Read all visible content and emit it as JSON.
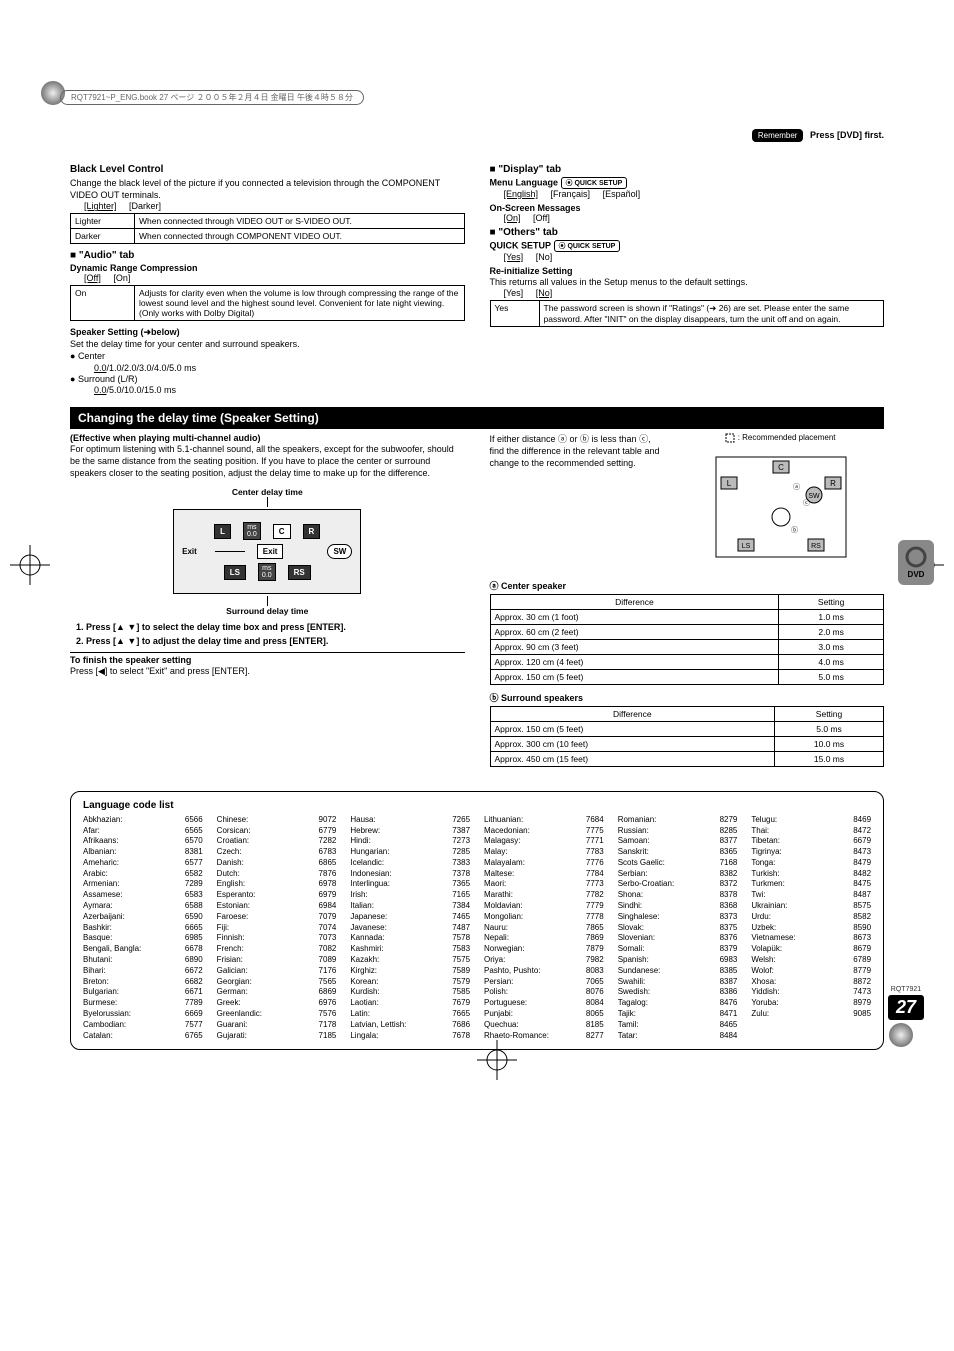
{
  "topbar_text": "RQT7921~P_ENG.book 27 ページ ２００５年２月４日 金曜日 午後４時５８分",
  "remember_pill": "Remember",
  "remember_text": "Press [DVD] first.",
  "left": {
    "blc_title": "Black Level Control",
    "blc_desc": "Change the black level of the picture if you connected a television through the COMPONENT VIDEO OUT terminals.",
    "blc_opts_lighter": "[Lighter]",
    "blc_opts_darker": "[Darker]",
    "blc_row1_k": "Lighter",
    "blc_row1_v": "When connected through VIDEO OUT or S-VIDEO OUT.",
    "blc_row2_k": "Darker",
    "blc_row2_v": "When connected through COMPONENT VIDEO OUT.",
    "audio_tab": "\"Audio\" tab",
    "drc_title": "Dynamic Range Compression",
    "drc_off": "[Off]",
    "drc_on": "[On]",
    "drc_row_k": "On",
    "drc_row_v": "Adjusts for clarity even when the volume is low through compressing the range of the lowest sound level and the highest sound level. Convenient for late night viewing. (Only works with Dolby Digital)",
    "spk_title": "Speaker Setting (➜below)",
    "spk_desc": "Set the delay time for your center and surround speakers.",
    "spk_center": "Center",
    "spk_center_vals": "0.0/1.0/2.0/3.0/4.0/5.0 ms",
    "spk_surr": "Surround (L/R)",
    "spk_surr_vals": "0.0/5.0/10.0/15.0 ms"
  },
  "right": {
    "display_tab": "\"Display\" tab",
    "menu_lang_title": "Menu Language",
    "menu_lang_opts": [
      "[English]",
      "[Français]",
      "[Español]"
    ],
    "osm_title": "On-Screen Messages",
    "osm_opts": [
      "[On]",
      "[Off]"
    ],
    "others_tab": "\"Others\" tab",
    "quick_title": "QUICK SETUP",
    "quick_opts": [
      "[Yes]",
      "[No]"
    ],
    "reinit_title": "Re-initialize Setting",
    "reinit_desc": "This returns all values in the Setup menus to the default settings.",
    "reinit_opts": [
      "[Yes]",
      "[No]"
    ],
    "reinit_row_k": "Yes",
    "reinit_row_v": "The password screen is shown if \"Ratings\" (➜ 26) are set. Please enter the same password. After \"INIT\" on the display disappears, turn the unit off and on again.",
    "quick_badge": "QUICK SETUP"
  },
  "delay": {
    "bar": "Changing the delay time (Speaker Setting)",
    "eff": "(Effective when playing multi-channel audio)",
    "para": "For optimum listening with 5.1-channel sound, all the speakers, except for the subwoofer, should be the same distance from the seating position. If you have to place the center or surround speakers closer to the seating position, adjust the delay time to make up for the difference.",
    "center_title": "Center delay time",
    "surround_title": "Surround delay time",
    "exit": "Exit",
    "ms": "ms",
    "ms_val": "0.0",
    "sp_L": "L",
    "sp_C": "C",
    "sp_R": "R",
    "sp_SW": "SW",
    "sp_LS": "LS",
    "sp_RS": "RS",
    "step1": "Press [▲ ▼] to select the delay time box and press [ENTER].",
    "step2": "Press [▲ ▼] to adjust the delay time and press [ENTER].",
    "finish_t": "To finish the speaker setting",
    "finish_b": "Press [◀] to select \"Exit\" and press [ENTER].",
    "either": "If either distance ⓐ or ⓑ is less than ⓒ, find the difference in the relevant table and change to the recommended setting.",
    "rec_placement": ": Recommended placement",
    "center_spk": "Center speaker",
    "surr_spk": "Surround speakers",
    "th_diff": "Difference",
    "th_set": "Setting",
    "center_rows": [
      [
        "Approx. 30 cm (1 foot)",
        "1.0 ms"
      ],
      [
        "Approx. 60 cm (2 feet)",
        "2.0 ms"
      ],
      [
        "Approx. 90 cm (3 feet)",
        "3.0 ms"
      ],
      [
        "Approx. 120 cm (4 feet)",
        "4.0 ms"
      ],
      [
        "Approx. 150 cm (5 feet)",
        "5.0 ms"
      ]
    ],
    "surr_rows": [
      [
        "Approx. 150 cm (5 feet)",
        "5.0 ms"
      ],
      [
        "Approx. 300 cm (10 feet)",
        "10.0 ms"
      ],
      [
        "Approx. 450 cm (15 feet)",
        "15.0 ms"
      ]
    ]
  },
  "lang": {
    "title": "Language code list",
    "cols": [
      [
        [
          "Abkhazian:",
          "6566"
        ],
        [
          "Afar:",
          "6565"
        ],
        [
          "Afrikaans:",
          "6570"
        ],
        [
          "Albanian:",
          "8381"
        ],
        [
          "Ameharic:",
          "6577"
        ],
        [
          "Arabic:",
          "6582"
        ],
        [
          "Armenian:",
          "7289"
        ],
        [
          "Assamese:",
          "6583"
        ],
        [
          "Aymara:",
          "6588"
        ],
        [
          "Azerbaijani:",
          "6590"
        ],
        [
          "Bashkir:",
          "6665"
        ],
        [
          "Basque:",
          "6985"
        ],
        [
          "Bengali, Bangla:",
          "6678"
        ],
        [
          "Bhutani:",
          "6890"
        ],
        [
          "Bihari:",
          "6672"
        ],
        [
          "Breton:",
          "6682"
        ],
        [
          "Bulgarian:",
          "6671"
        ],
        [
          "Burmese:",
          "7789"
        ],
        [
          "Byelorussian:",
          "6669"
        ],
        [
          "Cambodian:",
          "7577"
        ],
        [
          "Catalan:",
          "6765"
        ]
      ],
      [
        [
          "Chinese:",
          "9072"
        ],
        [
          "Corsican:",
          "6779"
        ],
        [
          "Croatian:",
          "7282"
        ],
        [
          "Czech:",
          "6783"
        ],
        [
          "Danish:",
          "6865"
        ],
        [
          "Dutch:",
          "7876"
        ],
        [
          "English:",
          "6978"
        ],
        [
          "Esperanto:",
          "6979"
        ],
        [
          "Estonian:",
          "6984"
        ],
        [
          "Faroese:",
          "7079"
        ],
        [
          "Fiji:",
          "7074"
        ],
        [
          "Finnish:",
          "7073"
        ],
        [
          "French:",
          "7082"
        ],
        [
          "Frisian:",
          "7089"
        ],
        [
          "Galician:",
          "7176"
        ],
        [
          "Georgian:",
          "7565"
        ],
        [
          "German:",
          "6869"
        ],
        [
          "Greek:",
          "6976"
        ],
        [
          "Greenlandic:",
          "7576"
        ],
        [
          "Guarani:",
          "7178"
        ],
        [
          "Gujarati:",
          "7185"
        ]
      ],
      [
        [
          "Hausa:",
          "7265"
        ],
        [
          "Hebrew:",
          "7387"
        ],
        [
          "Hindi:",
          "7273"
        ],
        [
          "Hungarian:",
          "7285"
        ],
        [
          "Icelandic:",
          "7383"
        ],
        [
          "Indonesian:",
          "7378"
        ],
        [
          "Interlingua:",
          "7365"
        ],
        [
          "Irish:",
          "7165"
        ],
        [
          "Italian:",
          "7384"
        ],
        [
          "Japanese:",
          "7465"
        ],
        [
          "Javanese:",
          "7487"
        ],
        [
          "Kannada:",
          "7578"
        ],
        [
          "Kashmiri:",
          "7583"
        ],
        [
          "Kazakh:",
          "7575"
        ],
        [
          "Kirghiz:",
          "7589"
        ],
        [
          "Korean:",
          "7579"
        ],
        [
          "Kurdish:",
          "7585"
        ],
        [
          "Laotian:",
          "7679"
        ],
        [
          "Latin:",
          "7665"
        ],
        [
          "Latvian, Lettish:",
          "7686"
        ],
        [
          "Lingala:",
          "7678"
        ]
      ],
      [
        [
          "Lithuanian:",
          "7684"
        ],
        [
          "Macedonian:",
          "7775"
        ],
        [
          "Malagasy:",
          "7771"
        ],
        [
          "Malay:",
          "7783"
        ],
        [
          "Malayalam:",
          "7776"
        ],
        [
          "Maltese:",
          "7784"
        ],
        [
          "Maori:",
          "7773"
        ],
        [
          "Marathi:",
          "7782"
        ],
        [
          "Moldavian:",
          "7779"
        ],
        [
          "Mongolian:",
          "7778"
        ],
        [
          "Nauru:",
          "7865"
        ],
        [
          "Nepali:",
          "7869"
        ],
        [
          "Norwegian:",
          "7879"
        ],
        [
          "Oriya:",
          "7982"
        ],
        [
          "Pashto, Pushto:",
          "8083"
        ],
        [
          "Persian:",
          "7065"
        ],
        [
          "Polish:",
          "8076"
        ],
        [
          "Portuguese:",
          "8084"
        ],
        [
          "Punjabi:",
          "8065"
        ],
        [
          "Quechua:",
          "8185"
        ],
        [
          "Rhaeto-Romance:",
          "8277"
        ]
      ],
      [
        [
          "Romanian:",
          "8279"
        ],
        [
          "Russian:",
          "8285"
        ],
        [
          "Samoan:",
          "8377"
        ],
        [
          "Sanskrit:",
          "8365"
        ],
        [
          "Scots Gaelic:",
          "7168"
        ],
        [
          "Serbian:",
          "8382"
        ],
        [
          "Serbo-Croatian:",
          "8372"
        ],
        [
          "Shona:",
          "8378"
        ],
        [
          "Sindhi:",
          "8368"
        ],
        [
          "Singhalese:",
          "8373"
        ],
        [
          "Slovak:",
          "8375"
        ],
        [
          "Slovenian:",
          "8376"
        ],
        [
          "Somali:",
          "8379"
        ],
        [
          "Spanish:",
          "6983"
        ],
        [
          "Sundanese:",
          "8385"
        ],
        [
          "Swahili:",
          "8387"
        ],
        [
          "Swedish:",
          "8386"
        ],
        [
          "Tagalog:",
          "8476"
        ],
        [
          "Tajik:",
          "8471"
        ],
        [
          "Tamil:",
          "8465"
        ],
        [
          "Tatar:",
          "8484"
        ]
      ],
      [
        [
          "Telugu:",
          "8469"
        ],
        [
          "Thai:",
          "8472"
        ],
        [
          "Tibetan:",
          "6679"
        ],
        [
          "Tigrinya:",
          "8473"
        ],
        [
          "Tonga:",
          "8479"
        ],
        [
          "Turkish:",
          "8482"
        ],
        [
          "Turkmen:",
          "8475"
        ],
        [
          "Twi:",
          "8487"
        ],
        [
          "Ukrainian:",
          "8575"
        ],
        [
          "Urdu:",
          "8582"
        ],
        [
          "Uzbek:",
          "8590"
        ],
        [
          "Vietnamese:",
          "8673"
        ],
        [
          "Volapük:",
          "8679"
        ],
        [
          "Welsh:",
          "6789"
        ],
        [
          "Wolof:",
          "8779"
        ],
        [
          "Xhosa:",
          "8872"
        ],
        [
          "Yiddish:",
          "7473"
        ],
        [
          "Yoruba:",
          "8979"
        ],
        [
          "Zulu:",
          "9085"
        ]
      ]
    ]
  },
  "footer": {
    "code": "RQT7921",
    "page": "27"
  },
  "dvd_label": "DVD"
}
